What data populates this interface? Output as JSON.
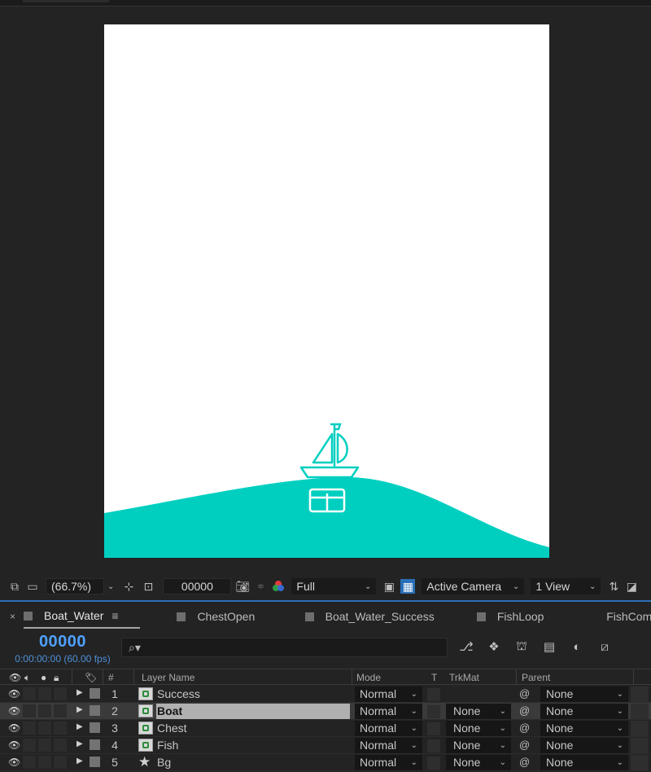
{
  "viewer": {
    "zoom": "(66.7%)",
    "frame": "00000",
    "resolution": "Full",
    "camera": "Active Camera",
    "views": "1 View"
  },
  "colors": {
    "accent": "#00CFC0",
    "timecode": "#4EA1FF",
    "panel_border": "#2A6FB8"
  },
  "tabs": [
    {
      "label": "Boat_Water",
      "active": true
    },
    {
      "label": "ChestOpen",
      "active": false
    },
    {
      "label": "Boat_Water_Success",
      "active": false
    },
    {
      "label": "FishLoop",
      "active": false
    },
    {
      "label": "FishComp",
      "active": false
    }
  ],
  "timeline": {
    "timecode": "00000",
    "time_sub": "0:00:00:00 (60.00 fps)",
    "search_glyph": "⌕▾"
  },
  "columns": {
    "hash": "#",
    "layer_name": "Layer Name",
    "mode": "Mode",
    "t": "T",
    "trkmat": "TrkMat",
    "parent": "Parent"
  },
  "layers": [
    {
      "num": "1",
      "name": "Success",
      "icon": "composition-icon",
      "mode": "Normal",
      "trkmat": "",
      "parent": "None",
      "selected": false
    },
    {
      "num": "2",
      "name": "Boat",
      "icon": "composition-icon",
      "mode": "Normal",
      "trkmat": "None",
      "parent": "None",
      "selected": true
    },
    {
      "num": "3",
      "name": "Chest",
      "icon": "composition-icon",
      "mode": "Normal",
      "trkmat": "None",
      "parent": "None",
      "selected": false
    },
    {
      "num": "4",
      "name": "Fish",
      "icon": "composition-icon",
      "mode": "Normal",
      "trkmat": "None",
      "parent": "None",
      "selected": false
    },
    {
      "num": "5",
      "name": "Bg",
      "icon": "shape-star-icon",
      "mode": "Normal",
      "trkmat": "None",
      "parent": "None",
      "selected": false
    }
  ]
}
